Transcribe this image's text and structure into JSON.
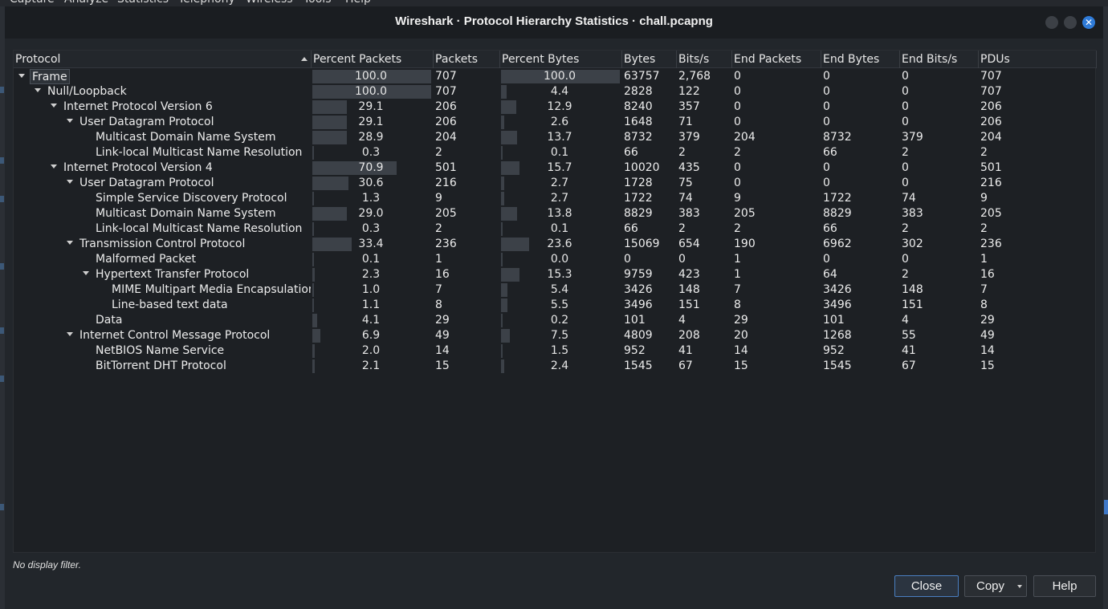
{
  "menubar": [
    "Capture",
    "Analyze",
    "Statistics",
    "Telephony",
    "Wireless",
    "Tools",
    "Help"
  ],
  "window": {
    "title": "Wireshark · Protocol Hierarchy Statistics · chall.pcapng"
  },
  "columns": [
    "Protocol",
    "Percent Packets",
    "Packets",
    "Percent Bytes",
    "Bytes",
    "Bits/s",
    "End Packets",
    "End Bytes",
    "End Bits/s",
    "PDUs"
  ],
  "rows": [
    {
      "name": "Frame",
      "depth": 0,
      "expanded": true,
      "pct_packets": "100.0",
      "packets": "707",
      "pct_bytes": "100.0",
      "bytes": "63757",
      "bits": "2,768",
      "end_packets": "0",
      "end_bytes": "0",
      "end_bits": "0",
      "pdus": "707"
    },
    {
      "name": "Null/Loopback",
      "depth": 1,
      "expanded": true,
      "pct_packets": "100.0",
      "packets": "707",
      "pct_bytes": "4.4",
      "bytes": "2828",
      "bits": "122",
      "end_packets": "0",
      "end_bytes": "0",
      "end_bits": "0",
      "pdus": "707"
    },
    {
      "name": "Internet Protocol Version 6",
      "depth": 2,
      "expanded": true,
      "pct_packets": "29.1",
      "packets": "206",
      "pct_bytes": "12.9",
      "bytes": "8240",
      "bits": "357",
      "end_packets": "0",
      "end_bytes": "0",
      "end_bits": "0",
      "pdus": "206"
    },
    {
      "name": "User Datagram Protocol",
      "depth": 3,
      "expanded": true,
      "pct_packets": "29.1",
      "packets": "206",
      "pct_bytes": "2.6",
      "bytes": "1648",
      "bits": "71",
      "end_packets": "0",
      "end_bytes": "0",
      "end_bits": "0",
      "pdus": "206"
    },
    {
      "name": "Multicast Domain Name System",
      "depth": 4,
      "expanded": false,
      "pct_packets": "28.9",
      "packets": "204",
      "pct_bytes": "13.7",
      "bytes": "8732",
      "bits": "379",
      "end_packets": "204",
      "end_bytes": "8732",
      "end_bits": "379",
      "pdus": "204"
    },
    {
      "name": "Link-local Multicast Name Resolution",
      "depth": 4,
      "expanded": false,
      "pct_packets": "0.3",
      "packets": "2",
      "pct_bytes": "0.1",
      "bytes": "66",
      "bits": "2",
      "end_packets": "2",
      "end_bytes": "66",
      "end_bits": "2",
      "pdus": "2"
    },
    {
      "name": "Internet Protocol Version 4",
      "depth": 2,
      "expanded": true,
      "pct_packets": "70.9",
      "packets": "501",
      "pct_bytes": "15.7",
      "bytes": "10020",
      "bits": "435",
      "end_packets": "0",
      "end_bytes": "0",
      "end_bits": "0",
      "pdus": "501"
    },
    {
      "name": "User Datagram Protocol",
      "depth": 3,
      "expanded": true,
      "pct_packets": "30.6",
      "packets": "216",
      "pct_bytes": "2.7",
      "bytes": "1728",
      "bits": "75",
      "end_packets": "0",
      "end_bytes": "0",
      "end_bits": "0",
      "pdus": "216"
    },
    {
      "name": "Simple Service Discovery Protocol",
      "depth": 4,
      "expanded": false,
      "pct_packets": "1.3",
      "packets": "9",
      "pct_bytes": "2.7",
      "bytes": "1722",
      "bits": "74",
      "end_packets": "9",
      "end_bytes": "1722",
      "end_bits": "74",
      "pdus": "9"
    },
    {
      "name": "Multicast Domain Name System",
      "depth": 4,
      "expanded": false,
      "pct_packets": "29.0",
      "packets": "205",
      "pct_bytes": "13.8",
      "bytes": "8829",
      "bits": "383",
      "end_packets": "205",
      "end_bytes": "8829",
      "end_bits": "383",
      "pdus": "205"
    },
    {
      "name": "Link-local Multicast Name Resolution",
      "depth": 4,
      "expanded": false,
      "pct_packets": "0.3",
      "packets": "2",
      "pct_bytes": "0.1",
      "bytes": "66",
      "bits": "2",
      "end_packets": "2",
      "end_bytes": "66",
      "end_bits": "2",
      "pdus": "2"
    },
    {
      "name": "Transmission Control Protocol",
      "depth": 3,
      "expanded": true,
      "pct_packets": "33.4",
      "packets": "236",
      "pct_bytes": "23.6",
      "bytes": "15069",
      "bits": "654",
      "end_packets": "190",
      "end_bytes": "6962",
      "end_bits": "302",
      "pdus": "236"
    },
    {
      "name": "Malformed Packet",
      "depth": 4,
      "expanded": false,
      "pct_packets": "0.1",
      "packets": "1",
      "pct_bytes": "0.0",
      "bytes": "0",
      "bits": "0",
      "end_packets": "1",
      "end_bytes": "0",
      "end_bits": "0",
      "pdus": "1"
    },
    {
      "name": "Hypertext Transfer Protocol",
      "depth": 4,
      "expanded": true,
      "pct_packets": "2.3",
      "packets": "16",
      "pct_bytes": "15.3",
      "bytes": "9759",
      "bits": "423",
      "end_packets": "1",
      "end_bytes": "64",
      "end_bits": "2",
      "pdus": "16"
    },
    {
      "name": "MIME Multipart Media Encapsulation",
      "depth": 5,
      "expanded": false,
      "pct_packets": "1.0",
      "packets": "7",
      "pct_bytes": "5.4",
      "bytes": "3426",
      "bits": "148",
      "end_packets": "7",
      "end_bytes": "3426",
      "end_bits": "148",
      "pdus": "7"
    },
    {
      "name": "Line-based text data",
      "depth": 5,
      "expanded": false,
      "pct_packets": "1.1",
      "packets": "8",
      "pct_bytes": "5.5",
      "bytes": "3496",
      "bits": "151",
      "end_packets": "8",
      "end_bytes": "3496",
      "end_bits": "151",
      "pdus": "8"
    },
    {
      "name": "Data",
      "depth": 4,
      "expanded": false,
      "pct_packets": "4.1",
      "packets": "29",
      "pct_bytes": "0.2",
      "bytes": "101",
      "bits": "4",
      "end_packets": "29",
      "end_bytes": "101",
      "end_bits": "4",
      "pdus": "29"
    },
    {
      "name": "Internet Control Message Protocol",
      "depth": 3,
      "expanded": true,
      "pct_packets": "6.9",
      "packets": "49",
      "pct_bytes": "7.5",
      "bytes": "4809",
      "bits": "208",
      "end_packets": "20",
      "end_bytes": "1268",
      "end_bits": "55",
      "pdus": "49"
    },
    {
      "name": "NetBIOS Name Service",
      "depth": 4,
      "expanded": false,
      "pct_packets": "2.0",
      "packets": "14",
      "pct_bytes": "1.5",
      "bytes": "952",
      "bits": "41",
      "end_packets": "14",
      "end_bytes": "952",
      "end_bits": "41",
      "pdus": "14"
    },
    {
      "name": "BitTorrent DHT Protocol",
      "depth": 4,
      "expanded": false,
      "pct_packets": "2.1",
      "packets": "15",
      "pct_bytes": "2.4",
      "bytes": "1545",
      "bits": "67",
      "end_packets": "15",
      "end_bytes": "1545",
      "end_bits": "67",
      "pdus": "15"
    }
  ],
  "footer": {
    "filter_text": "No display filter."
  },
  "buttons": {
    "close": "Close",
    "copy": "Copy",
    "help": "Help"
  }
}
